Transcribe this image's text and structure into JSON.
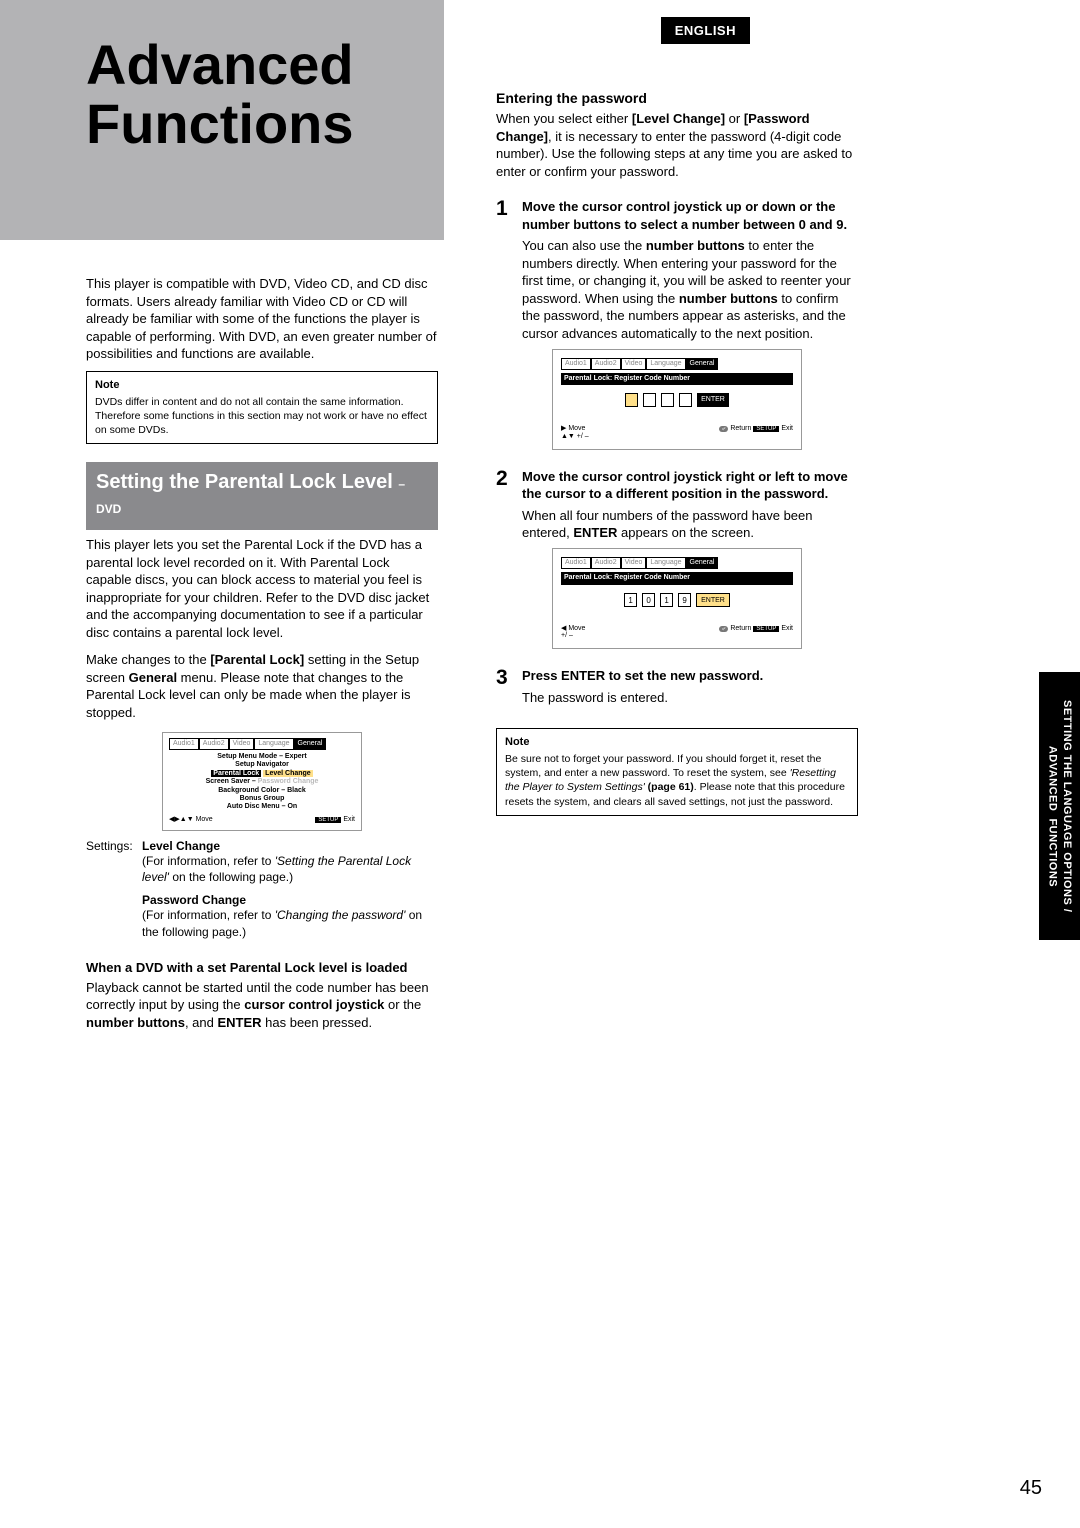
{
  "language_tag": "ENGLISH",
  "title_line1": "Advanced",
  "title_line2": "Functions",
  "thumb_tab": "SETTING THE LANGUAGE OPTIONS /\n             ADVANCED  FUNCTIONS",
  "page_number": "45",
  "left": {
    "intro": "This player is compatible with DVD, Video CD, and CD disc formats. Users already familiar with Video CD or CD will already be familiar with some of the functions the player is capable of performing. With DVD, an even greater number of possibilities and functions are available.",
    "note_label": "Note",
    "note_text": "DVDs differ in content and do not all contain the same information. Therefore some functions in this section may not work or have no effect on some DVDs.",
    "section_title_main": "Setting the Parental Lock Level",
    "section_title_sub": "– DVD",
    "para1": "This player lets you set the Parental Lock if the DVD has a parental lock level recorded on it. With Parental Lock capable discs, you can block access to material you feel is inappropriate for your children. Refer to the DVD disc jacket and the accompanying documentation to see if a particular disc contains a parental lock level.",
    "para2_pre": "Make changes to the ",
    "para2_bold": "[Parental Lock]",
    "para2_mid": " setting in the Setup screen ",
    "para2_bold2": "General",
    "para2_post": " menu. Please note that changes to the Parental Lock level can only be made when the player is stopped.",
    "osd1": {
      "tabs": [
        "Audio1",
        "Audio2",
        "Video",
        "Language",
        "General"
      ],
      "rows": [
        "Setup Menu Mode – Expert",
        "Setup Navigator",
        {
          "left": "Parental Lock",
          "right": "Level Change",
          "hl": true
        },
        {
          "left": "Screen Saver –",
          "right": "Password Change",
          "dim": true
        },
        "Background Color – Black",
        "Bonus Group",
        "Auto Disc Menu – On"
      ],
      "foot_left": "◀▶▲▼ Move",
      "foot_right_pill": "SETUP",
      "foot_right": "Exit"
    },
    "settings_label": "Settings:",
    "opt1_title": "Level Change",
    "opt1_desc_pre": "(For information, refer to ",
    "opt1_desc_em": "'Setting the Parental Lock level'",
    "opt1_desc_post": " on the following page.)",
    "opt2_title": "Password Change",
    "opt2_desc_pre": "(For information, refer to ",
    "opt2_desc_em": "'Changing the password'",
    "opt2_desc_post": " on the following page.)",
    "loaded_heading": "When a DVD with a set Parental Lock level is loaded",
    "loaded_text_pre": "Playback cannot be started until the code number has been correctly input by using the ",
    "loaded_text_b1": "cursor control joystick",
    "loaded_text_mid": " or the ",
    "loaded_text_b2": "number buttons",
    "loaded_text_mid2": ", and ",
    "loaded_text_b3": "ENTER",
    "loaded_text_post": " has been pressed."
  },
  "right": {
    "h_entering": "Entering the password",
    "enter_pre": "When you select either ",
    "enter_b1": "[Level Change]",
    "enter_mid": " or ",
    "enter_b2": "[Password Change]",
    "enter_post": ", it is necessary to enter the password (4-digit code number). Use the following steps at any time you are asked to enter or confirm your password.",
    "step1_head": "Move the cursor control joystick up or down or the number buttons to select a number between 0 and 9.",
    "step1_body_pre": "You can also use the ",
    "step1_body_b1": "number buttons",
    "step1_body_mid": " to enter the numbers directly. When entering your password for the first time, or changing it, you will be asked to reenter your password. When using the ",
    "step1_body_b2": "number buttons",
    "step1_body_post": " to confirm the password, the numbers appear as asterisks, and the cursor advances automatically  to the next position.",
    "osd2": {
      "tabs": [
        "Audio1",
        "Audio2",
        "Video",
        "Language",
        "General"
      ],
      "bar": "Parental Lock: Register Code Number",
      "digits": [
        "",
        "",
        "",
        ""
      ],
      "active_digit": 0,
      "enter": "ENTER",
      "foot_left1": "▶ Move",
      "foot_left2": "▲▼ +/ –",
      "foot_ret": "Return",
      "foot_pill": "SETUP",
      "foot_exit": "Exit"
    },
    "step2_head": "Move the cursor control joystick right or left to move the cursor to a different position in the password.",
    "step2_body_pre": "When all four numbers of the password have been entered, ",
    "step2_body_b": "ENTER",
    "step2_body_post": " appears on the screen.",
    "osd3": {
      "tabs": [
        "Audio1",
        "Audio2",
        "Video",
        "Language",
        "General"
      ],
      "bar": "Parental Lock: Register Code Number",
      "digits": [
        "1",
        "0",
        "1",
        "9"
      ],
      "enter": "ENTER",
      "foot_left1": "◀   Move",
      "foot_left2": "     +/ –",
      "foot_ret": "Return",
      "foot_pill": "SETUP",
      "foot_exit": "Exit"
    },
    "step3_head": "Press ENTER to set the new password.",
    "step3_body": "The password is entered.",
    "note_label": "Note",
    "note_pre": "Be sure not to forget your password. If you should forget it, reset the system, and enter a new password. To reset the system, see ",
    "note_em": "'Resetting the Player to System Settings'",
    "note_b": " (page 61)",
    "note_post": ". Please note that this procedure resets the system, and clears all saved settings, not just the password."
  }
}
